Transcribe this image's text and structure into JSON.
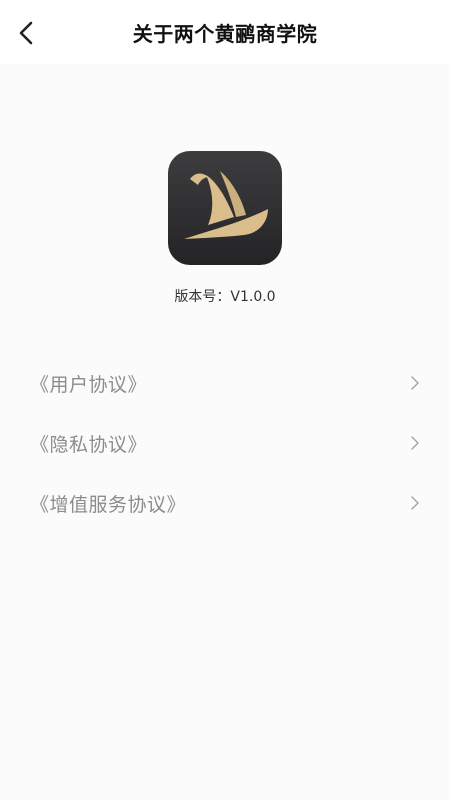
{
  "header": {
    "title": "关于两个黄鹂商学院",
    "back_icon": "chevron-left-icon"
  },
  "about": {
    "logo_icon": "sailboat-logo",
    "version_label": "版本号：",
    "version_value": "V1.0.0"
  },
  "menu": {
    "items": [
      {
        "label": "《用户协议》",
        "icon": "chevron-right-icon"
      },
      {
        "label": "《隐私协议》",
        "icon": "chevron-right-icon"
      },
      {
        "label": "《增值服务协议》",
        "icon": "chevron-right-icon"
      }
    ]
  },
  "colors": {
    "background": "#fcfbfc",
    "logo_bg": "#2f2e30",
    "logo_gold": "#d9bd8a",
    "menu_text": "#8c8c8c"
  }
}
